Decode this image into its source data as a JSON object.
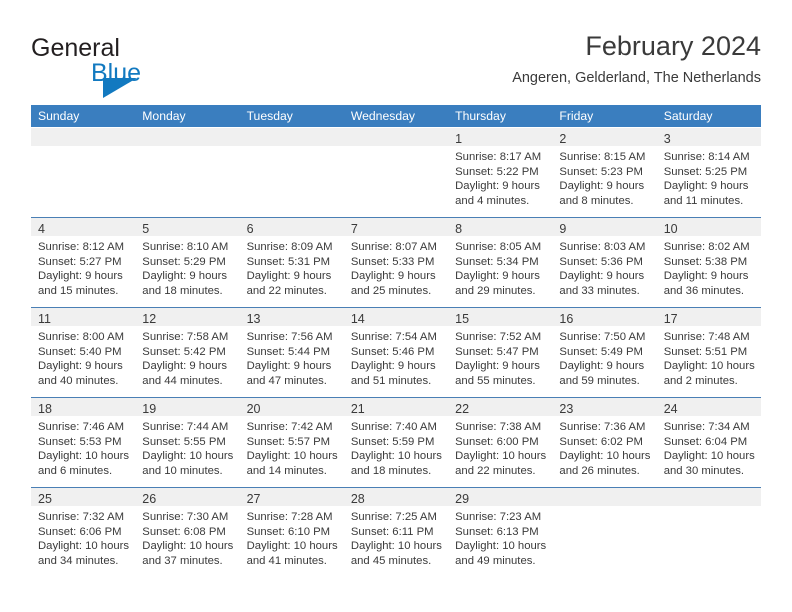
{
  "brand": {
    "name_part1": "General",
    "name_part2": "Blue",
    "triangle_color": "#1279c0",
    "text_color": "#231f20"
  },
  "header": {
    "title": "February 2024",
    "subtitle": "Angeren, Gelderland, The Netherlands"
  },
  "colors": {
    "header_row_bg": "#3a7ebf",
    "header_row_text": "#ffffff",
    "day_band_bg": "#f0f0f0",
    "week_separator": "#4a7fb5",
    "body_text": "#3a3a3a"
  },
  "weekdays": [
    "Sunday",
    "Monday",
    "Tuesday",
    "Wednesday",
    "Thursday",
    "Friday",
    "Saturday"
  ],
  "weeks": [
    [
      {
        "day": "",
        "lines": []
      },
      {
        "day": "",
        "lines": []
      },
      {
        "day": "",
        "lines": []
      },
      {
        "day": "",
        "lines": []
      },
      {
        "day": "1",
        "lines": [
          "Sunrise: 8:17 AM",
          "Sunset: 5:22 PM",
          "Daylight: 9 hours",
          "and 4 minutes."
        ]
      },
      {
        "day": "2",
        "lines": [
          "Sunrise: 8:15 AM",
          "Sunset: 5:23 PM",
          "Daylight: 9 hours",
          "and 8 minutes."
        ]
      },
      {
        "day": "3",
        "lines": [
          "Sunrise: 8:14 AM",
          "Sunset: 5:25 PM",
          "Daylight: 9 hours",
          "and 11 minutes."
        ]
      }
    ],
    [
      {
        "day": "4",
        "lines": [
          "Sunrise: 8:12 AM",
          "Sunset: 5:27 PM",
          "Daylight: 9 hours",
          "and 15 minutes."
        ]
      },
      {
        "day": "5",
        "lines": [
          "Sunrise: 8:10 AM",
          "Sunset: 5:29 PM",
          "Daylight: 9 hours",
          "and 18 minutes."
        ]
      },
      {
        "day": "6",
        "lines": [
          "Sunrise: 8:09 AM",
          "Sunset: 5:31 PM",
          "Daylight: 9 hours",
          "and 22 minutes."
        ]
      },
      {
        "day": "7",
        "lines": [
          "Sunrise: 8:07 AM",
          "Sunset: 5:33 PM",
          "Daylight: 9 hours",
          "and 25 minutes."
        ]
      },
      {
        "day": "8",
        "lines": [
          "Sunrise: 8:05 AM",
          "Sunset: 5:34 PM",
          "Daylight: 9 hours",
          "and 29 minutes."
        ]
      },
      {
        "day": "9",
        "lines": [
          "Sunrise: 8:03 AM",
          "Sunset: 5:36 PM",
          "Daylight: 9 hours",
          "and 33 minutes."
        ]
      },
      {
        "day": "10",
        "lines": [
          "Sunrise: 8:02 AM",
          "Sunset: 5:38 PM",
          "Daylight: 9 hours",
          "and 36 minutes."
        ]
      }
    ],
    [
      {
        "day": "11",
        "lines": [
          "Sunrise: 8:00 AM",
          "Sunset: 5:40 PM",
          "Daylight: 9 hours",
          "and 40 minutes."
        ]
      },
      {
        "day": "12",
        "lines": [
          "Sunrise: 7:58 AM",
          "Sunset: 5:42 PM",
          "Daylight: 9 hours",
          "and 44 minutes."
        ]
      },
      {
        "day": "13",
        "lines": [
          "Sunrise: 7:56 AM",
          "Sunset: 5:44 PM",
          "Daylight: 9 hours",
          "and 47 minutes."
        ]
      },
      {
        "day": "14",
        "lines": [
          "Sunrise: 7:54 AM",
          "Sunset: 5:46 PM",
          "Daylight: 9 hours",
          "and 51 minutes."
        ]
      },
      {
        "day": "15",
        "lines": [
          "Sunrise: 7:52 AM",
          "Sunset: 5:47 PM",
          "Daylight: 9 hours",
          "and 55 minutes."
        ]
      },
      {
        "day": "16",
        "lines": [
          "Sunrise: 7:50 AM",
          "Sunset: 5:49 PM",
          "Daylight: 9 hours",
          "and 59 minutes."
        ]
      },
      {
        "day": "17",
        "lines": [
          "Sunrise: 7:48 AM",
          "Sunset: 5:51 PM",
          "Daylight: 10 hours",
          "and 2 minutes."
        ]
      }
    ],
    [
      {
        "day": "18",
        "lines": [
          "Sunrise: 7:46 AM",
          "Sunset: 5:53 PM",
          "Daylight: 10 hours",
          "and 6 minutes."
        ]
      },
      {
        "day": "19",
        "lines": [
          "Sunrise: 7:44 AM",
          "Sunset: 5:55 PM",
          "Daylight: 10 hours",
          "and 10 minutes."
        ]
      },
      {
        "day": "20",
        "lines": [
          "Sunrise: 7:42 AM",
          "Sunset: 5:57 PM",
          "Daylight: 10 hours",
          "and 14 minutes."
        ]
      },
      {
        "day": "21",
        "lines": [
          "Sunrise: 7:40 AM",
          "Sunset: 5:59 PM",
          "Daylight: 10 hours",
          "and 18 minutes."
        ]
      },
      {
        "day": "22",
        "lines": [
          "Sunrise: 7:38 AM",
          "Sunset: 6:00 PM",
          "Daylight: 10 hours",
          "and 22 minutes."
        ]
      },
      {
        "day": "23",
        "lines": [
          "Sunrise: 7:36 AM",
          "Sunset: 6:02 PM",
          "Daylight: 10 hours",
          "and 26 minutes."
        ]
      },
      {
        "day": "24",
        "lines": [
          "Sunrise: 7:34 AM",
          "Sunset: 6:04 PM",
          "Daylight: 10 hours",
          "and 30 minutes."
        ]
      }
    ],
    [
      {
        "day": "25",
        "lines": [
          "Sunrise: 7:32 AM",
          "Sunset: 6:06 PM",
          "Daylight: 10 hours",
          "and 34 minutes."
        ]
      },
      {
        "day": "26",
        "lines": [
          "Sunrise: 7:30 AM",
          "Sunset: 6:08 PM",
          "Daylight: 10 hours",
          "and 37 minutes."
        ]
      },
      {
        "day": "27",
        "lines": [
          "Sunrise: 7:28 AM",
          "Sunset: 6:10 PM",
          "Daylight: 10 hours",
          "and 41 minutes."
        ]
      },
      {
        "day": "28",
        "lines": [
          "Sunrise: 7:25 AM",
          "Sunset: 6:11 PM",
          "Daylight: 10 hours",
          "and 45 minutes."
        ]
      },
      {
        "day": "29",
        "lines": [
          "Sunrise: 7:23 AM",
          "Sunset: 6:13 PM",
          "Daylight: 10 hours",
          "and 49 minutes."
        ]
      },
      {
        "day": "",
        "lines": []
      },
      {
        "day": "",
        "lines": []
      }
    ]
  ]
}
